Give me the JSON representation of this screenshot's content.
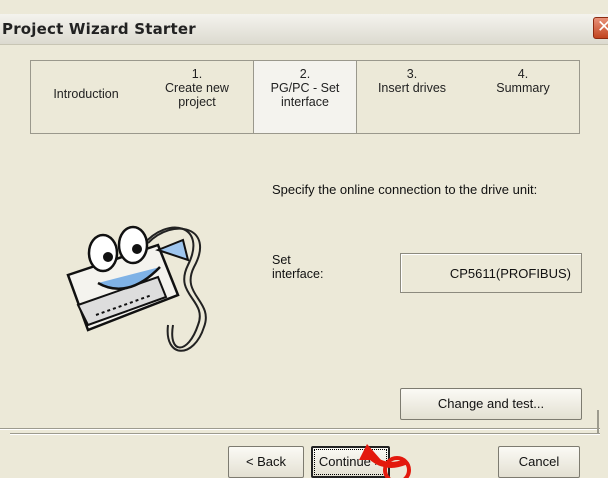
{
  "window": {
    "title": "Project Wizard Starter",
    "close_icon": "close-icon"
  },
  "steps": [
    {
      "num": "",
      "label": "Introduction",
      "active": false
    },
    {
      "num": "1.",
      "label": "Create new project",
      "active": false
    },
    {
      "num": "2.",
      "label": "PG/PC - Set interface",
      "active": true
    },
    {
      "num": "3.",
      "label": "Insert drives",
      "active": false
    },
    {
      "num": "4.",
      "label": "Summary",
      "active": false
    }
  ],
  "main": {
    "prompt": "Specify the online connection to the drive unit:",
    "set_interface_label": "Set interface:",
    "interface_value": "CP5611(PROFIBUS)",
    "change_test_label": "Change and test...",
    "mascot_icon": "serial-cable-mascot-icon"
  },
  "footer": {
    "back_label": "< Back",
    "continue_label": "Continue >",
    "cancel_label": "Cancel"
  },
  "colors": {
    "dialog_bg": "#ece9d8",
    "close_red": "#c1441f",
    "annotation_red": "#e3190d"
  }
}
